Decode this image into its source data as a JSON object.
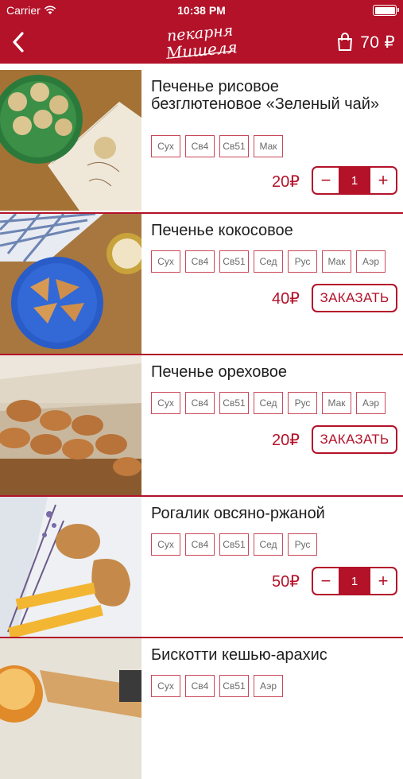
{
  "status_bar": {
    "carrier": "Carrier",
    "time": "10:38 PM"
  },
  "nav": {
    "back_icon": "chevron-left-icon",
    "logo_line1": "пекарня",
    "logo_line2": "Мишеля",
    "cart_total": "70 ₽",
    "cart_icon": "shopping-bag-icon"
  },
  "colors": {
    "brand": "#b31229",
    "tag_border": "#c9485b",
    "tag_text": "#6a6a6a"
  },
  "items": [
    {
      "title": "Печенье рисовое безглютеновое «Зеленый чай»",
      "tags": [
        "Сух",
        "Св4",
        "Св51",
        "Мак"
      ],
      "price": "20₽",
      "control": "stepper",
      "qty": "1",
      "photo": "green-tea-rice-cookies-photo"
    },
    {
      "title": "Печенье кокосовое",
      "tags": [
        "Сух",
        "Св4",
        "Св51",
        "Сед",
        "Рус",
        "Мак",
        "Аэр"
      ],
      "price": "40₽",
      "control": "order",
      "order_label": "ЗАКАЗАТЬ",
      "photo": "coconut-cookies-photo"
    },
    {
      "title": "Печенье ореховое",
      "tags": [
        "Сух",
        "Св4",
        "Св51",
        "Сед",
        "Рус",
        "Мак",
        "Аэр"
      ],
      "price": "20₽",
      "control": "order",
      "order_label": "ЗАКАЗАТЬ",
      "photo": "nut-cookies-photo"
    },
    {
      "title": "Рогалик овсяно-ржаной",
      "tags": [
        "Сух",
        "Св4",
        "Св51",
        "Сед",
        "Рус"
      ],
      "price": "50₽",
      "control": "stepper",
      "qty": "1",
      "photo": "oat-rye-roll-photo"
    },
    {
      "title": "Бискотти кешью-арахис",
      "tags": [
        "Сух",
        "Св4",
        "Св51",
        "Аэр"
      ],
      "photo": "biscotti-photo"
    }
  ]
}
